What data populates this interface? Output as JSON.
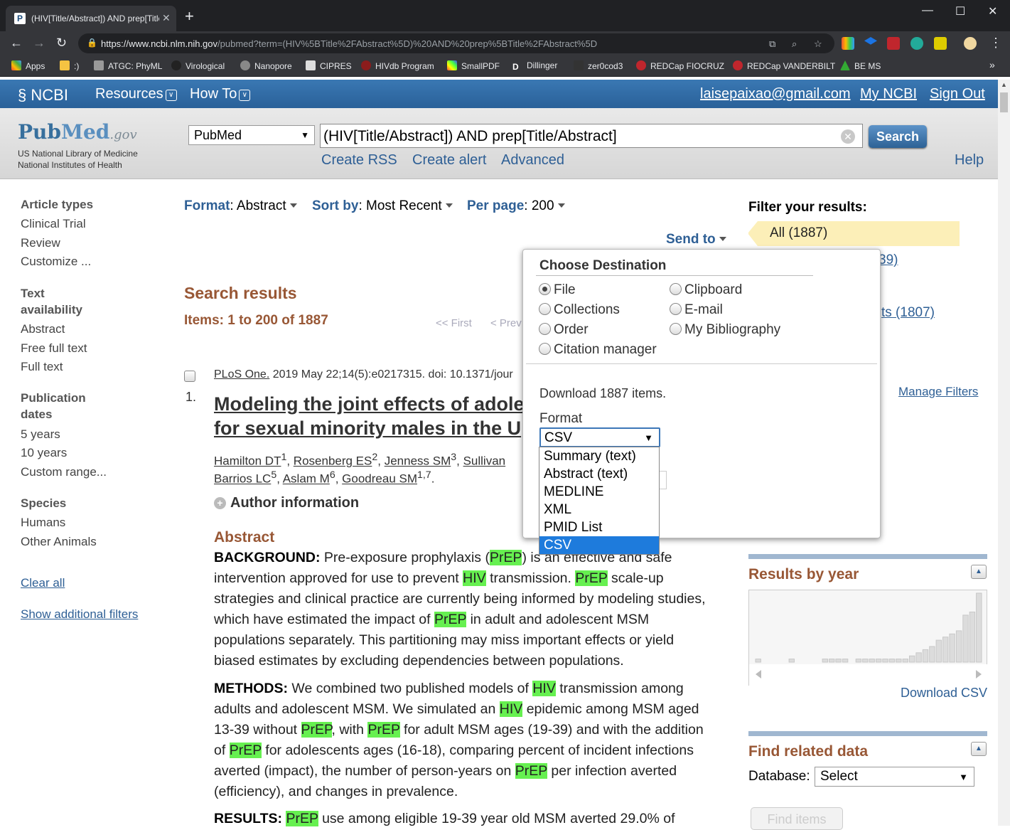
{
  "browser": {
    "tab_title": "(HIV[Title/Abstract]) AND prep[Title/Abstract]",
    "url_host": "https://www.ncbi.nlm.nih.gov",
    "url_path": "/pubmed?term=(HIV%5BTitle%2FAbstract%5D)%20AND%20prep%5BTitle%2FAbstract%5D",
    "bookmarks": [
      {
        "label": "Apps",
        "icon": "apps-grid-icon"
      },
      {
        "label": ":)",
        "icon": "folder-icon"
      },
      {
        "label": "ATGC: PhyML",
        "icon": "atgc-icon"
      },
      {
        "label": "Virological",
        "icon": "virological-icon"
      },
      {
        "label": "Nanopore",
        "icon": "nanopore-icon"
      },
      {
        "label": "CIPRES",
        "icon": "cipres-icon"
      },
      {
        "label": "HIVdb Program",
        "icon": "hivdb-icon"
      },
      {
        "label": "SmallPDF",
        "icon": "smallpdf-icon"
      },
      {
        "label": "Dillinger",
        "icon": "dillinger-icon"
      },
      {
        "label": "zer0cod3",
        "icon": "zerocode-icon"
      },
      {
        "label": "REDCap FIOCRUZ",
        "icon": "redcap-icon"
      },
      {
        "label": "REDCap VANDERBILT",
        "icon": "redcap-icon"
      },
      {
        "label": "BE MS",
        "icon": "bems-icon"
      }
    ],
    "more_bookmarks": "»"
  },
  "ncbi": {
    "brand": "NCBI",
    "resources": "Resources",
    "howto": "How To",
    "email": "laisepaixao@gmail.com",
    "my_ncbi": "My NCBI",
    "sign_out": "Sign Out"
  },
  "search": {
    "logo_pub": "Pub",
    "logo_med": "Med",
    "logo_gov": ".gov",
    "nlm_line1": "US National Library of Medicine",
    "nlm_line2": "National Institutes of Health",
    "database": "PubMed",
    "query": "(HIV[Title/Abstract]) AND prep[Title/Abstract]",
    "search_button": "Search",
    "create_rss": "Create RSS",
    "create_alert": "Create alert",
    "advanced": "Advanced",
    "help": "Help"
  },
  "left": {
    "article_types": "Article types",
    "clinical_trial": "Clinical Trial",
    "review": "Review",
    "customize": "Customize ...",
    "text_avail_1": "Text",
    "text_avail_2": "availability",
    "abstract": "Abstract",
    "free_full_text": "Free full text",
    "full_text": "Full text",
    "pub_dates_1": "Publication",
    "pub_dates_2": "dates",
    "five_years": "5 years",
    "ten_years": "10 years",
    "custom_range": "Custom range...",
    "species": "Species",
    "humans": "Humans",
    "other_animals": "Other Animals",
    "clear_all": "Clear all",
    "show_more": "Show additional filters"
  },
  "results": {
    "format_label": "Format",
    "format_value": ": Abstract",
    "sort_label": "Sort by",
    "sort_value": ": Most Recent",
    "perpage_label": "Per page",
    "perpage_value": ": 200",
    "send_to": "Send to",
    "heading": "Search results",
    "items": "Items: 1 to 200 of 1887",
    "first": "<< First",
    "prev": "< Prev",
    "record_number": "1.",
    "journal": "PLoS One.",
    "citation": " 2019 May 22;14(5):e0217315. doi: 10.1371/jour",
    "title_line1": "Modeling the joint effects of adole",
    "title_line2": "for sexual minority males in the U",
    "authors_line1_a": "Hamilton DT",
    "authors_line1_a_sup": "1",
    "authors_line1_b": "Rosenberg ES",
    "authors_line1_b_sup": "2",
    "authors_line1_c": "Jenness SM",
    "authors_line1_c_sup": "3",
    "authors_line1_d": "Sullivan",
    "authors_line2_a": "Barrios LC",
    "authors_line2_a_sup": "5",
    "authors_line2_b": "Aslam M",
    "authors_line2_b_sup": "6",
    "authors_line2_c": "Goodreau SM",
    "authors_line2_c_sup": "1,7",
    "author_info": "Author information",
    "abstract_heading": "Abstract"
  },
  "right": {
    "filter_head": "Filter your results:",
    "all": "All (1887)",
    "partial_1": "39)",
    "partial_2": "ts (1807)",
    "manage_filters": "Manage Filters",
    "results_by_year": "Results by year",
    "download_csv": "Download CSV",
    "find_related": "Find related data",
    "database_label": "Database:",
    "database_value": "Select",
    "find_items": "Find items"
  },
  "year_chart_data": {
    "type": "bar",
    "values": [
      1,
      0,
      0,
      0,
      0,
      1,
      0,
      0,
      0,
      0,
      1,
      1,
      1,
      1,
      0,
      1,
      1,
      1,
      1,
      1,
      1,
      1,
      1,
      2,
      3,
      4,
      5,
      7,
      8,
      9,
      10,
      15,
      16,
      22
    ]
  },
  "popup": {
    "heading": "Choose Destination",
    "file": "File",
    "clipboard": "Clipboard",
    "collections": "Collections",
    "email": "E-mail",
    "order": "Order",
    "bibliography": "My Bibliography",
    "citation_manager": "Citation manager",
    "download_count": "Download 1887 items.",
    "format_label": "Format",
    "format_value": "CSV",
    "options": [
      "Summary (text)",
      "Abstract (text)",
      "MEDLINE",
      "XML",
      "PMID List",
      "CSV"
    ]
  },
  "colors": {
    "ncbi_blue": "#2e6ca8",
    "link": "#2e5f95",
    "brown": "#985735",
    "highlight": "#66f050",
    "selected_option": "#1e7bdc"
  }
}
